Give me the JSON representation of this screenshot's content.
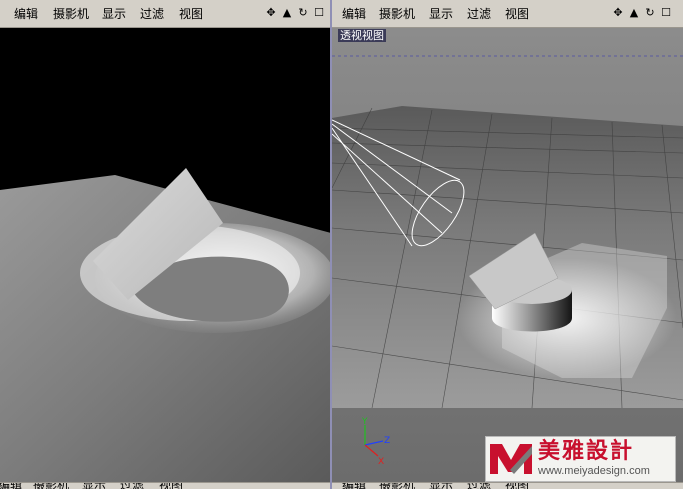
{
  "menu": {
    "edit": "编辑",
    "camera": "摄影机",
    "display": "显示",
    "filter": "过滤",
    "view": "视图"
  },
  "toolbar_icons": [
    "move-icon",
    "zoom-icon",
    "rotate-icon",
    "maximize-icon"
  ],
  "left_viewport": {
    "name": "render-preview"
  },
  "right_viewport": {
    "label": "透视视图",
    "axes": {
      "x": "X",
      "y": "Y",
      "z": "Z"
    }
  },
  "watermark": {
    "name": "美雅設計",
    "url": "www.meiyadesign.com"
  },
  "colors": {
    "menubar": "#d4d0c8",
    "viewport_bg": "#7a7a7a",
    "view_label_bg": "#3b3b58",
    "axis_x": "#e02020",
    "axis_y": "#20c020",
    "axis_z": "#2040ff"
  }
}
